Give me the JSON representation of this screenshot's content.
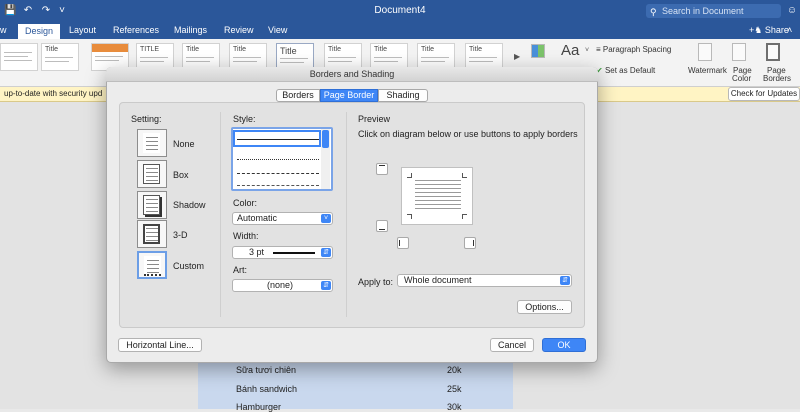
{
  "titlebar": {
    "doc_title": "Document4",
    "search_placeholder": "Search in Document"
  },
  "tabs": [
    {
      "label": "w"
    },
    {
      "label": "Design"
    },
    {
      "label": "Layout"
    },
    {
      "label": "References"
    },
    {
      "label": "Mailings"
    },
    {
      "label": "Review"
    },
    {
      "label": "View"
    }
  ],
  "share_label": "Share",
  "ribbon": {
    "thumbnails": [
      "Title",
      "TITLE",
      "Title",
      "Title",
      "Title",
      "Title",
      "Title",
      "Title",
      "Title",
      "Title"
    ],
    "paragraph_spacing": "Paragraph Spacing",
    "set_as_default": "Set as Default",
    "watermark": "Watermark",
    "page_color_line1": "Page",
    "page_color_line2": "Color",
    "page_borders_line1": "Page",
    "page_borders_line2": "Borders"
  },
  "notice": {
    "text": "up-to-date with security upd",
    "button": "Check for Updates"
  },
  "menu": [
    {
      "item": "Sữa tươi chiên",
      "price": "20k"
    },
    {
      "item": "Bánh sandwich",
      "price": "25k"
    },
    {
      "item": "Hamburger",
      "price": "30k"
    }
  ],
  "dialog": {
    "title": "Borders and Shading",
    "tabs": [
      "Borders",
      "Page Border",
      "Shading"
    ],
    "setting_label": "Setting:",
    "settings": [
      "None",
      "Box",
      "Shadow",
      "3-D",
      "Custom"
    ],
    "style_label": "Style:",
    "color_label": "Color:",
    "color_value": "Automatic",
    "width_label": "Width:",
    "width_value": "3 pt",
    "art_label": "Art:",
    "art_value": "(none)",
    "preview_label": "Preview",
    "preview_hint": "Click on diagram below or use buttons to apply borders",
    "apply_to_label": "Apply to:",
    "apply_to_value": "Whole document",
    "options_button": "Options...",
    "horizontal_line_button": "Horizontal Line...",
    "cancel_button": "Cancel",
    "ok_button": "OK"
  },
  "colors": {
    "word_blue": "#2b579a",
    "accent": "#3e86f6",
    "table_fill": "#c9d8ee"
  }
}
